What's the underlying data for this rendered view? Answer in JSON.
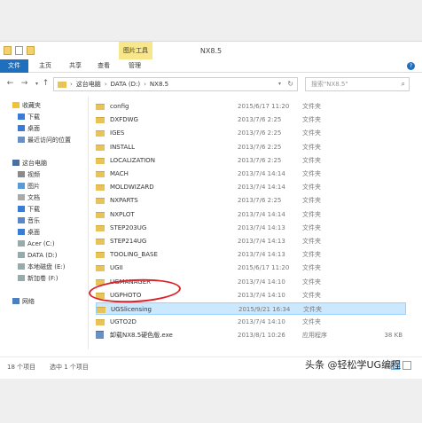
{
  "window": {
    "title": "NX8.5",
    "tool_tab": "图片工具",
    "ribbon_tabs": [
      "文件",
      "主页",
      "共享",
      "查看",
      "管理"
    ]
  },
  "address": {
    "path": [
      "这台电脑",
      "DATA (D:)",
      "NX8.5"
    ],
    "search_placeholder": "搜索\"NX8.5\""
  },
  "nav": {
    "favorites_header": "收藏夹",
    "favorites": [
      "下载",
      "桌面",
      "最近访问的位置"
    ],
    "pc_header": "这台电脑",
    "pc_items": [
      "视频",
      "图片",
      "文档",
      "下载",
      "音乐",
      "桌面",
      "Acer (C:)",
      "DATA (D:)",
      "本地磁盘 (E:)",
      "新加卷 (F:)"
    ],
    "network": "网络"
  },
  "files": [
    {
      "name": "config",
      "date": "2015/6/17 11:20",
      "type": "文件夹",
      "size": ""
    },
    {
      "name": "DXFDWG",
      "date": "2013/7/6 2:25",
      "type": "文件夹",
      "size": ""
    },
    {
      "name": "IGES",
      "date": "2013/7/6 2:25",
      "type": "文件夹",
      "size": ""
    },
    {
      "name": "INSTALL",
      "date": "2013/7/6 2:25",
      "type": "文件夹",
      "size": ""
    },
    {
      "name": "LOCALIZATION",
      "date": "2013/7/6 2:25",
      "type": "文件夹",
      "size": ""
    },
    {
      "name": "MACH",
      "date": "2013/7/4 14:14",
      "type": "文件夹",
      "size": ""
    },
    {
      "name": "MOLDWIZARD",
      "date": "2013/7/4 14:14",
      "type": "文件夹",
      "size": ""
    },
    {
      "name": "NXPARTS",
      "date": "2013/7/6 2:25",
      "type": "文件夹",
      "size": ""
    },
    {
      "name": "NXPLOT",
      "date": "2013/7/4 14:14",
      "type": "文件夹",
      "size": ""
    },
    {
      "name": "STEP203UG",
      "date": "2013/7/4 14:13",
      "type": "文件夹",
      "size": ""
    },
    {
      "name": "STEP214UG",
      "date": "2013/7/4 14:13",
      "type": "文件夹",
      "size": ""
    },
    {
      "name": "TOOLING_BASE",
      "date": "2013/7/4 14:13",
      "type": "文件夹",
      "size": ""
    },
    {
      "name": "UGII",
      "date": "2015/6/17 11:20",
      "type": "文件夹",
      "size": ""
    },
    {
      "name": "UGMANAGER",
      "date": "2013/7/4 14:10",
      "type": "文件夹",
      "size": ""
    },
    {
      "name": "UGPHOTO",
      "date": "2013/7/4 14:10",
      "type": "文件夹",
      "size": ""
    },
    {
      "name": "UGSlicensing",
      "date": "2015/9/21 16:34",
      "type": "文件夹",
      "size": "",
      "selected": true
    },
    {
      "name": "UGTO2D",
      "date": "2013/7/4 14:10",
      "type": "文件夹",
      "size": ""
    },
    {
      "name": "卸载NX8.5硬色版.exe",
      "date": "2013/8/1 10:26",
      "type": "应用程序",
      "size": "38 KB"
    }
  ],
  "status": {
    "count": "18 个项目",
    "selected": "选中 1 个项目"
  },
  "watermark": "头条 @轻松学UG编程",
  "icons": {
    "back": "arrow-left-icon",
    "forward": "arrow-right-icon",
    "up": "arrow-up-icon",
    "refresh": "refresh-icon",
    "search": "magnifier-icon"
  },
  "colors": {
    "accent": "#1f6fbf",
    "selection": "#cce8ff",
    "highlight_circle": "#d8232a"
  }
}
